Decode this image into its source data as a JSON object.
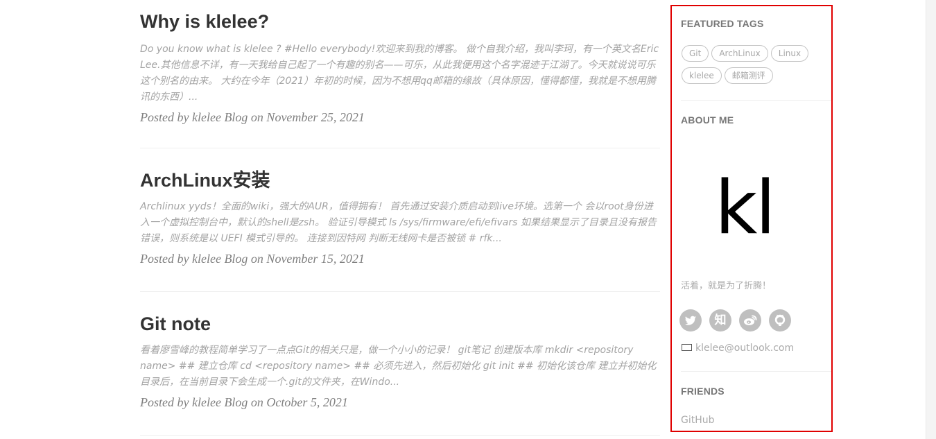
{
  "posts": [
    {
      "title": "Why is klelee?",
      "excerpt": "Do you know what is klelee ? #Hello everybody!欢迎来到我的博客。 做个自我介绍，我叫李珂，有一个英文名Eric Lee.其他信息不详，有一天我给自己起了一个有趣的别名——可乐，从此我便用这个名字混迹于江湖了。今天就说说可乐这个别名的由来。 大约在今年（2021）年初的时候，因为不想用qq邮箱的缘故（具体原因，懂得都懂，我就是不想用腾讯的东西）...",
      "meta": "Posted by klelee Blog on November 25, 2021"
    },
    {
      "title": "ArchLinux安装",
      "excerpt": "Archlinux yyds！全面的wiki，强大的AUR，值得拥有！ 首先通过安装介质启动到live环境。选第一个 会以root身份进入一个虚拟控制台中，默认的shell是zsh。 验证引导模式 ls /sys/firmware/efi/efivars 如果结果显示了目录且没有报告错误，则系统是以 UEFI 模式引导的。 连接到因特网 判断无线网卡是否被锁 # rfk...",
      "meta": "Posted by klelee Blog on November 15, 2021"
    },
    {
      "title": "Git note",
      "excerpt": "看着廖雪峰的教程简单学习了一点点Git的相关只是，做一个小小的记录！ git笔记 创建版本库 mkdir <repository name> ## 建立仓库 cd <repository name> ## 必须先进入，然后初始化 git init ## 初始化该仓库 建立并初始化目录后，在当前目录下会生成一个.git的文件夹，在Windo...",
      "meta": "Posted by klelee Blog on October 5, 2021"
    }
  ],
  "sidebar": {
    "featured_tags": {
      "title": "FEATURED TAGS",
      "tags": [
        "Git",
        "ArchLinux",
        "Linux",
        "klelee",
        "邮箱测评"
      ]
    },
    "about": {
      "title": "ABOUT ME",
      "avatar_text": "kl",
      "motto": "活着，就是为了折腾！",
      "social": [
        {
          "name": "twitter-icon",
          "glyph": ""
        },
        {
          "name": "zhihu-icon",
          "glyph": "知"
        },
        {
          "name": "weibo-icon",
          "glyph": ""
        },
        {
          "name": "github-icon",
          "glyph": ""
        }
      ],
      "email": "klelee@outlook.com"
    },
    "friends": {
      "title": "FRIENDS",
      "links": [
        "GitHub"
      ]
    }
  },
  "colors": {
    "highlight_border": "#e00000",
    "social_bg": "#bfbfbf"
  }
}
